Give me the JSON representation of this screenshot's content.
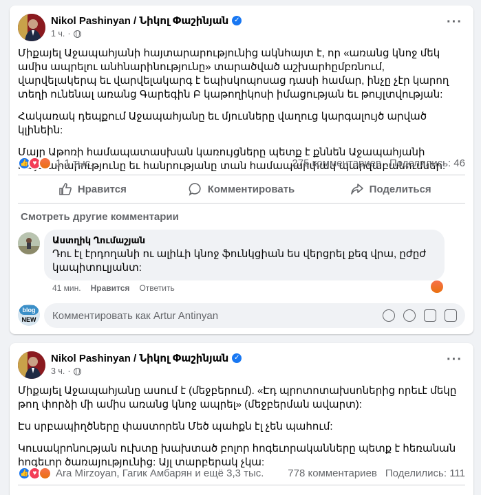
{
  "posts": [
    {
      "author": "Nikol Pashinyan / Նիկոլ Փաշինյան",
      "time": "1 ч.",
      "paragraphs": [
        "Միքայել Աջապահյանի հայտարարությունից ակնհայտ է, որ «առանց կնոջ մեկ ամիս ապրելու անհնարինությունը» տարածված աշխարհըմբռնում, վարվելակերպ եւ վարվելակարգ է եպիսկոպոսաց դասի համար, ինչը չէր կարող տեղի ունենալ առանց Գարեգին Բ կաթողիկոսի իմացության եւ թույլտվության:",
        "Հակառակ դեպքում Աջապահյանը եւ մյուսները վաղուց կարգալույծ արված կլինեին:",
        "Մայր Աթոռի համապատասխան կառույցները պետք է քննեն Աջապահյանի հայտարարությունը եւ հանրությանը տան համապարփակ պարզաբանումներ:"
      ],
      "reactions_count": "1,1 тыс.",
      "comments_count": "275 комментариев",
      "shares_count": "Поделились: 46"
    },
    {
      "author": "Nikol Pashinyan / Նիկոլ Փաշինյան",
      "time": "3 ч.",
      "paragraphs": [
        "Միքայել Աջապահյանը ասում է (մեջբերում). «Էդ պրոտոտախսոներից որեւէ մեկը թող փորձի մի ամիս առանց կնոջ ապրել» (մեջբերման ավարտ):",
        "Էս սրբապիղծները փաստորեն Մեծ պահքն էլ չեն պահում:",
        "Կուսակրոնության ուխտը խախտած բոլոր հոգեւորականները պետք է հեռանան հոգեւոր ծառայությունից: Այլ տարբերակ չկա:"
      ],
      "reactions_count": "Ara Mirzoyan, Гагик Амбарян и ещё 3,3 тыс.",
      "comments_count": "778 комментариев",
      "shares_count": "Поделились: 111"
    }
  ],
  "actions": {
    "like": "Нравится",
    "comment": "Комментировать",
    "share": "Поделиться"
  },
  "see_more_comments": "Смотреть другие комментарии",
  "comment": {
    "author": "Աստղիկ Ղումաշյան",
    "text": "Դու էլ էրդողանի ու ալիևի կնոջ ֆունկցիան ես վերցրել քեզ վրա, ըժըժ կապիտուլյանտ:",
    "time": "41 мин.",
    "like": "Нравится",
    "reply": "Ответить"
  },
  "comment_input": {
    "placeholder": "Комментировать как Artur Antinyan",
    "avatar_label_top": "blog",
    "avatar_label_bottom": "NEW"
  },
  "colors": {
    "accent": "#1877f2",
    "love": "#f33e58",
    "angry": "#e9710f"
  }
}
